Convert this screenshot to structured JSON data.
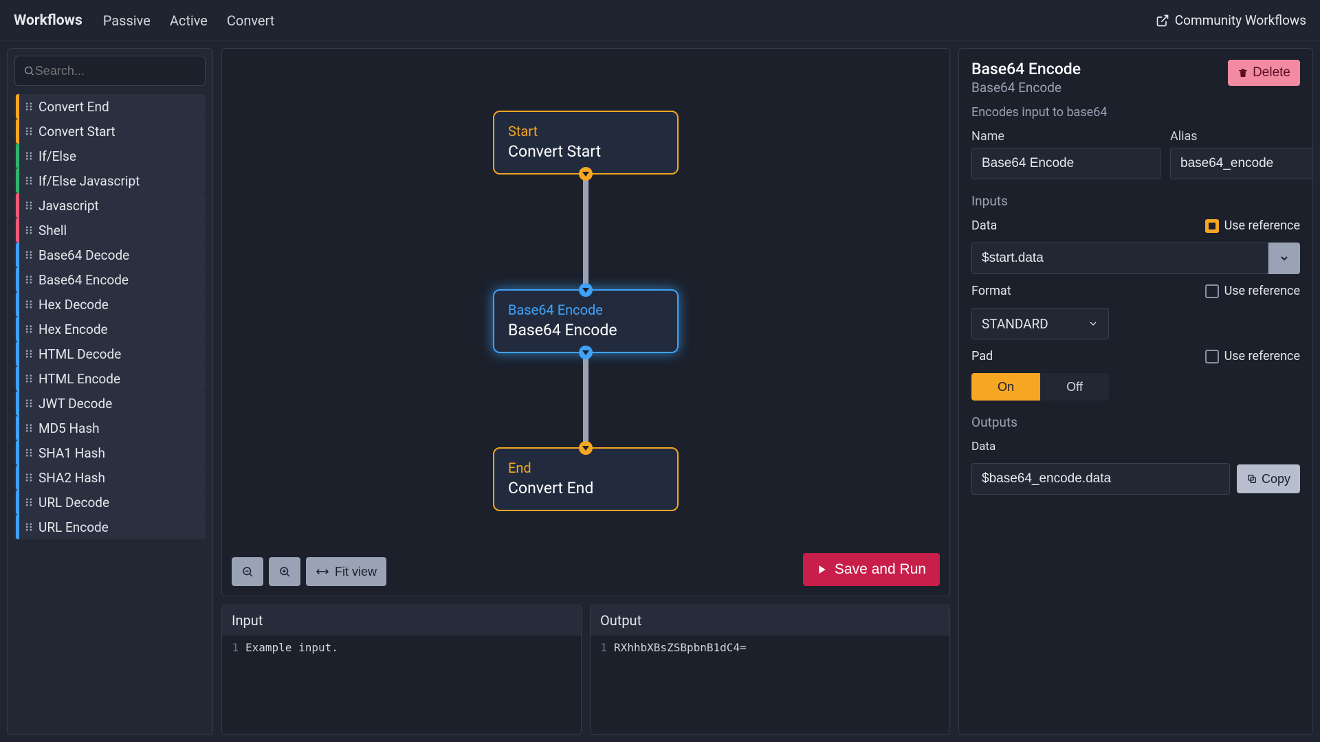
{
  "topnav": {
    "brand": "Workflows",
    "tabs": [
      "Passive",
      "Active",
      "Convert"
    ],
    "community": "Community Workflows"
  },
  "search": {
    "placeholder": "Search..."
  },
  "palette": [
    {
      "label": "Convert End",
      "color": "#f5a623"
    },
    {
      "label": "Convert Start",
      "color": "#f5a623"
    },
    {
      "label": "If/Else",
      "color": "#30b46c"
    },
    {
      "label": "If/Else Javascript",
      "color": "#30b46c"
    },
    {
      "label": "Javascript",
      "color": "#ef5a78"
    },
    {
      "label": "Shell",
      "color": "#ef5a78"
    },
    {
      "label": "Base64 Decode",
      "color": "#3fa2f7"
    },
    {
      "label": "Base64 Encode",
      "color": "#3fa2f7"
    },
    {
      "label": "Hex Decode",
      "color": "#3fa2f7"
    },
    {
      "label": "Hex Encode",
      "color": "#3fa2f7"
    },
    {
      "label": "HTML Decode",
      "color": "#3fa2f7"
    },
    {
      "label": "HTML Encode",
      "color": "#3fa2f7"
    },
    {
      "label": "JWT Decode",
      "color": "#3fa2f7"
    },
    {
      "label": "MD5 Hash",
      "color": "#3fa2f7"
    },
    {
      "label": "SHA1 Hash",
      "color": "#3fa2f7"
    },
    {
      "label": "SHA2 Hash",
      "color": "#3fa2f7"
    },
    {
      "label": "URL Decode",
      "color": "#3fa2f7"
    },
    {
      "label": "URL Encode",
      "color": "#3fa2f7"
    }
  ],
  "canvas": {
    "nodes": {
      "start": {
        "kind": "Start",
        "title": "Convert Start"
      },
      "mid": {
        "kind": "Base64 Encode",
        "title": "Base64 Encode"
      },
      "end": {
        "kind": "End",
        "title": "Convert End"
      }
    },
    "toolbar": {
      "fit": "Fit view"
    },
    "saveRun": "Save and Run"
  },
  "io": {
    "input": {
      "header": "Input",
      "line": "Example input."
    },
    "output": {
      "header": "Output",
      "line": "RXhhbXBsZSBpbnB1dC4="
    }
  },
  "inspector": {
    "title": "Base64 Encode",
    "subtitle": "Base64 Encode",
    "deleteLabel": "Delete",
    "description": "Encodes input to base64",
    "nameLabel": "Name",
    "nameValue": "Base64 Encode",
    "aliasLabel": "Alias",
    "aliasValue": "base64_encode",
    "inputsHeader": "Inputs",
    "dataLabel": "Data",
    "useRef": "Use reference",
    "dataValue": "$start.data",
    "formatLabel": "Format",
    "formatValue": "STANDARD",
    "padLabel": "Pad",
    "padOn": "On",
    "padOff": "Off",
    "outputsHeader": "Outputs",
    "outDataLabel": "Data",
    "outDataValue": "$base64_encode.data",
    "copyLabel": "Copy"
  }
}
